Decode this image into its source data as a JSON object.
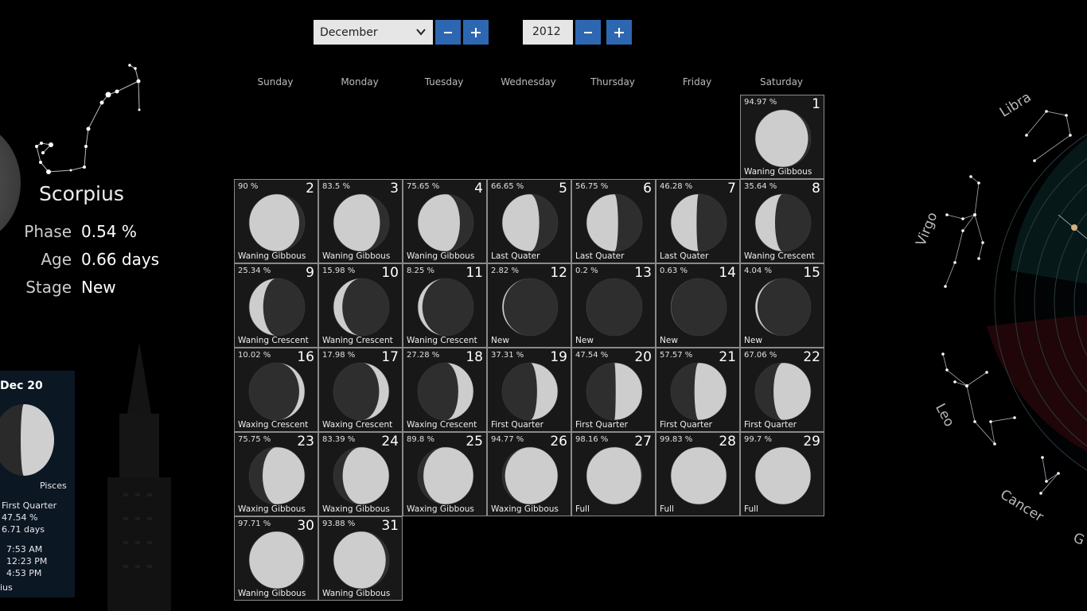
{
  "controls": {
    "month_value": "December",
    "year_value": "2012"
  },
  "weekdays": [
    "Sunday",
    "Monday",
    "Tuesday",
    "Wednesday",
    "Thursday",
    "Friday",
    "Saturday"
  ],
  "days": [
    {
      "day": "1",
      "percent": "94.97 %",
      "stage": "Waning Gibbous"
    },
    {
      "day": "2",
      "percent": "90 %",
      "stage": "Waning Gibbous"
    },
    {
      "day": "3",
      "percent": "83.5 %",
      "stage": "Waning Gibbous"
    },
    {
      "day": "4",
      "percent": "75.65 %",
      "stage": "Waning Gibbous"
    },
    {
      "day": "5",
      "percent": "66.65 %",
      "stage": "Last Quater"
    },
    {
      "day": "6",
      "percent": "56.75 %",
      "stage": "Last Quater"
    },
    {
      "day": "7",
      "percent": "46.28 %",
      "stage": "Last Quater"
    },
    {
      "day": "8",
      "percent": "35.64 %",
      "stage": "Waning Crescent"
    },
    {
      "day": "9",
      "percent": "25.34 %",
      "stage": "Waning Crescent"
    },
    {
      "day": "10",
      "percent": "15.98 %",
      "stage": "Waning Crescent"
    },
    {
      "day": "11",
      "percent": "8.25 %",
      "stage": "Waning Crescent"
    },
    {
      "day": "12",
      "percent": "2.82 %",
      "stage": "New"
    },
    {
      "day": "13",
      "percent": "0.2 %",
      "stage": "New"
    },
    {
      "day": "14",
      "percent": "0.63 %",
      "stage": "New"
    },
    {
      "day": "15",
      "percent": "4.04 %",
      "stage": "New"
    },
    {
      "day": "16",
      "percent": "10.02 %",
      "stage": "Waxing Crescent"
    },
    {
      "day": "17",
      "percent": "17.98 %",
      "stage": "Waxing Crescent"
    },
    {
      "day": "18",
      "percent": "27.28 %",
      "stage": "Waxing Crescent"
    },
    {
      "day": "19",
      "percent": "37.31 %",
      "stage": "First Quarter"
    },
    {
      "day": "20",
      "percent": "47.54 %",
      "stage": "First Quarter"
    },
    {
      "day": "21",
      "percent": "57.57 %",
      "stage": "First Quarter"
    },
    {
      "day": "22",
      "percent": "67.06 %",
      "stage": "First Quarter"
    },
    {
      "day": "23",
      "percent": "75.75 %",
      "stage": "Waxing Gibbous"
    },
    {
      "day": "24",
      "percent": "83.39 %",
      "stage": "Waxing Gibbous"
    },
    {
      "day": "25",
      "percent": "89.8 %",
      "stage": "Waxing Gibbous"
    },
    {
      "day": "26",
      "percent": "94.77 %",
      "stage": "Waxing Gibbous"
    },
    {
      "day": "27",
      "percent": "98.16 %",
      "stage": "Full"
    },
    {
      "day": "28",
      "percent": "99.83 %",
      "stage": "Full"
    },
    {
      "day": "29",
      "percent": "99.7 %",
      "stage": "Full"
    },
    {
      "day": "30",
      "percent": "97.71 %",
      "stage": "Waning Gibbous"
    },
    {
      "day": "31",
      "percent": "93.88 %",
      "stage": "Waning Gibbous"
    }
  ],
  "info": {
    "constellation": "Scorpius",
    "phase_label": "Phase",
    "phase_value": "0.54 %",
    "age_label": "Age",
    "age_value": "0.66 days",
    "stage_label": "Stage",
    "stage_value": "New"
  },
  "card": {
    "date": "Dec 20",
    "constellation": "Pisces",
    "stage": "First Quarter",
    "percent": "47.54 %",
    "age": "6.71 days",
    "time1": "7:53 AM",
    "time2": "12:23 PM",
    "time3": "4:53 PM",
    "footer": "ius"
  },
  "zodiac": [
    "Libra",
    "Virgo",
    "Leo",
    "Cancer",
    "G"
  ],
  "icons": [
    "chevron-down-icon",
    "minus-icon",
    "plus-icon",
    "moon-icon"
  ]
}
